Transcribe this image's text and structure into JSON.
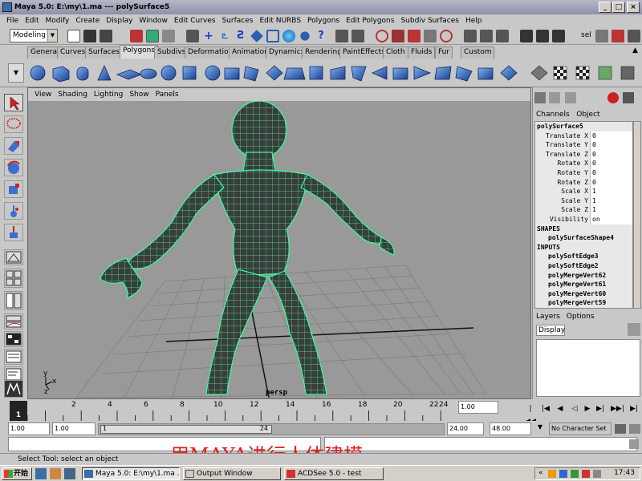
{
  "window": {
    "title": "Maya 5.0: E:\\my\\1.ma   ---   polySurface5"
  },
  "menubar": [
    "File",
    "Edit",
    "Modify",
    "Create",
    "Display",
    "Window",
    "Edit Curves",
    "Surfaces",
    "Edit NURBS",
    "Polygons",
    "Edit Polygons",
    "Subdiv Surfaces",
    "Help"
  ],
  "status_line": {
    "mode": "Modeling",
    "sel_label": "sel"
  },
  "shelf_tabs": [
    "General",
    "Curves",
    "Surfaces",
    "Polygons",
    "Subdivs",
    "Deformation",
    "Animation",
    "Dynamics",
    "Rendering",
    "PaintEffects",
    "Cloth",
    "Fluids",
    "Fur",
    "Custom"
  ],
  "active_shelf_tab": "Polygons",
  "viewport": {
    "menu": [
      "View",
      "Shading",
      "Lighting",
      "Show",
      "Panels"
    ],
    "camera_label": "persp",
    "axis_y": "y",
    "axis_x": "x",
    "axis_z": "z"
  },
  "channel_box": {
    "menu": [
      "Channels",
      "Object"
    ],
    "object_name": "polySurface5",
    "channels": [
      {
        "label": "Translate X",
        "value": "0"
      },
      {
        "label": "Translate Y",
        "value": "0"
      },
      {
        "label": "Translate Z",
        "value": "0"
      },
      {
        "label": "Rotate X",
        "value": "0"
      },
      {
        "label": "Rotate Y",
        "value": "0"
      },
      {
        "label": "Rotate Z",
        "value": "0"
      },
      {
        "label": "Scale X",
        "value": "1"
      },
      {
        "label": "Scale Y",
        "value": "1"
      },
      {
        "label": "Scale Z",
        "value": "1"
      },
      {
        "label": "Visibility",
        "value": "on"
      }
    ],
    "shapes_header": "SHAPES",
    "shapes": [
      "polySurfaceShape4"
    ],
    "inputs_header": "INPUTS",
    "inputs": [
      "polySoftEdge3",
      "polySoftEdge2",
      "polyMergeVert62",
      "polyMergeVert61",
      "polyMergeVert60",
      "polyMergeVert59"
    ]
  },
  "layers": {
    "menu": [
      "Layers",
      "Options"
    ],
    "display": "Display"
  },
  "time_slider": {
    "ticks": [
      "2",
      "4",
      "6",
      "8",
      "10",
      "12",
      "14",
      "16",
      "18",
      "20",
      "22",
      "24"
    ],
    "current_frame": "1",
    "frame_field": "1.00"
  },
  "range_slider": {
    "start": "1.00",
    "inner_start": "1.00",
    "range_in": "1",
    "range_out": "24",
    "end": "24.00",
    "outer_end": "48.00",
    "character_set": "No Character Set"
  },
  "overlay_caption": "用MAYA进行人体建模",
  "help_line": "Select Tool: select an object",
  "taskbar": {
    "start": "开始",
    "tasks": [
      "Maya 5.0: E:\\my\\1.ma ...",
      "Output Window",
      "ACDSee 5.0 - test"
    ],
    "clock": "17:43"
  },
  "colors": {
    "wire": "#37ff9a",
    "mesh": "#3c3c3c",
    "grid": "#787878",
    "shelf_blue": "#2a5fb0",
    "overlay": "#e02020"
  }
}
